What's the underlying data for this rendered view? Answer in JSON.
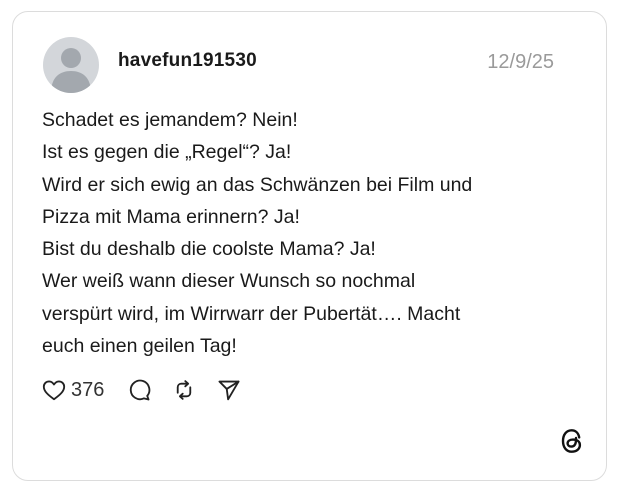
{
  "post": {
    "username": "havefun191530",
    "date": "12/9/25",
    "lines": [
      "Schadet es jemandem? Nein!",
      "Ist es gegen die „Regel“? Ja!",
      "Wird er sich ewig an das Schwänzen bei Film und",
      "Pizza mit Mama erinnern? Ja!",
      "Bist du deshalb die coolste Mama? Ja!",
      "Wer weiß wann dieser Wunsch so nochmal",
      "verspürt wird, im Wirrwarr der Pubertät…. Macht",
      "euch einen geilen Tag!"
    ]
  },
  "actions": {
    "like_count": "376",
    "icons": [
      "heart-icon",
      "comment-icon",
      "repost-icon",
      "share-icon"
    ]
  },
  "branding": {
    "logo": "threads-logo-icon"
  },
  "colors": {
    "text": "#1a1a1a",
    "muted": "#9a9a9a",
    "border": "#dcdcdc",
    "avatar_bg": "#d3d6da",
    "avatar_fg": "#a3a8ae"
  }
}
